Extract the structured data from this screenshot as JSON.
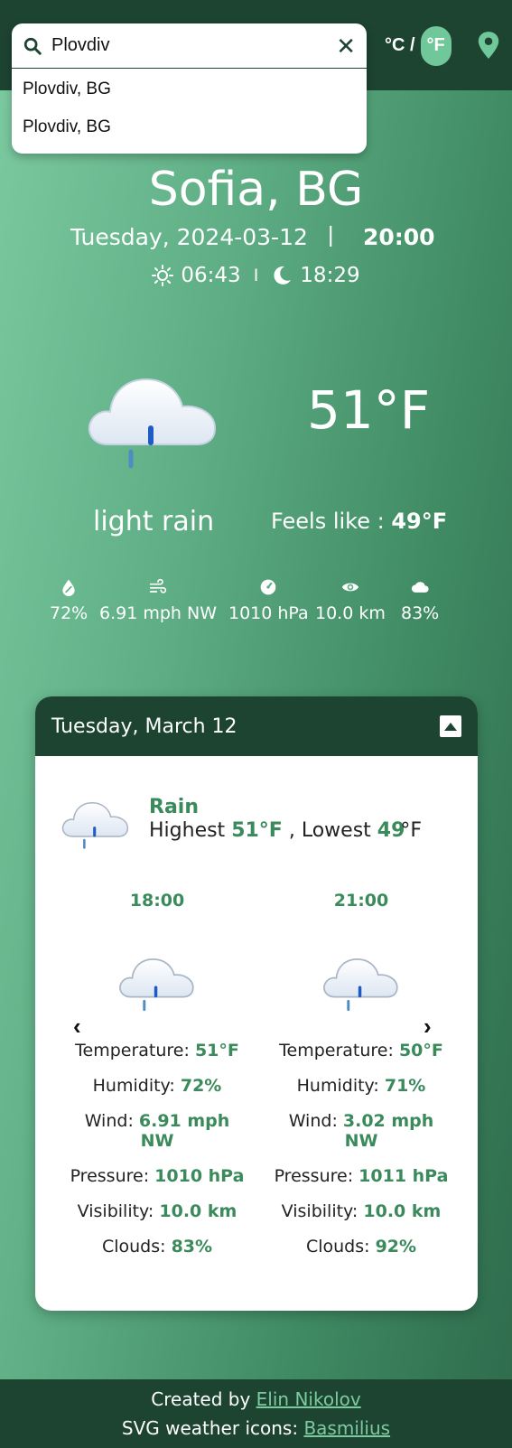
{
  "search": {
    "value": "Plovdiv",
    "suggestions": [
      "Plovdiv, BG",
      "Plovdiv, BG"
    ]
  },
  "units": {
    "celsius_label": "°C /",
    "fahrenheit_label": "°F",
    "active": "F"
  },
  "current": {
    "city": "Sofia, BG",
    "date": "Tuesday, 2024-03-12",
    "separator": "|",
    "time": "20:00",
    "sunrise": "06:43",
    "sun_separator": "I",
    "sunset": "18:29",
    "temperature": "51°F",
    "description": "light rain",
    "feels_like_label": "Feels like :",
    "feels_like_value": "49°F",
    "stats": {
      "humidity": "72%",
      "wind": "6.91 mph NW",
      "pressure": "1010 hPa",
      "visibility": "10.0 km",
      "clouds": "83%"
    }
  },
  "forecast": {
    "day_title": "Tuesday, March 12",
    "summary": {
      "condition": "Rain",
      "highest_label": "Highest",
      "highest": "51°F",
      "lowest_label": ", Lowest",
      "lowest_num": "49",
      "lowest_unit": "°F"
    },
    "labels": {
      "temperature": "Temperature:",
      "humidity": "Humidity:",
      "wind": "Wind:",
      "pressure": "Pressure:",
      "visibility": "Visibility:",
      "clouds": "Clouds:"
    },
    "slots": [
      {
        "hour": "18:00",
        "temperature": "51°F",
        "humidity": "72%",
        "wind": "6.91 mph NW",
        "pressure": "1010 hPa",
        "visibility": "10.0 km",
        "clouds": "83%"
      },
      {
        "hour": "21:00",
        "temperature": "50°F",
        "humidity": "71%",
        "wind": "3.02 mph NW",
        "pressure": "1011 hPa",
        "visibility": "10.0 km",
        "clouds": "92%"
      }
    ],
    "prev_arrow": "‹",
    "next_arrow": "›"
  },
  "footer": {
    "created_by": "Created by",
    "author": "Elin Nikolov",
    "icons_label": "SVG weather icons:",
    "icons_author": "Basmilius"
  },
  "colors": {
    "header": "#1d4331",
    "accent": "#3a8a5c",
    "toggle": "#6fc79a"
  }
}
